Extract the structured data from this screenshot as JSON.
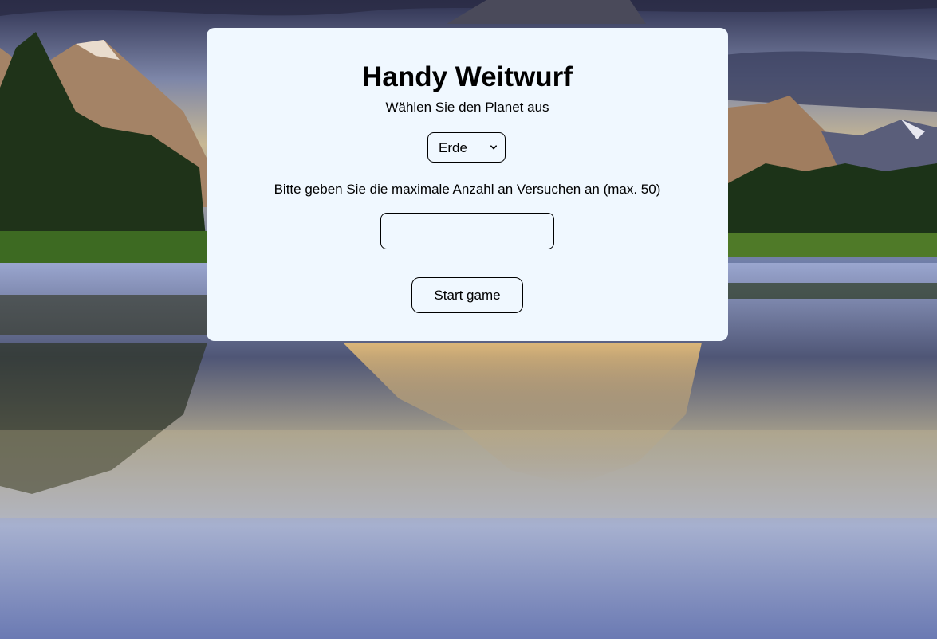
{
  "page": {
    "background": "mountain-lake-landscape"
  },
  "card": {
    "title": "Handy Weitwurf",
    "planet_prompt": "Wählen Sie den Planet aus",
    "planet_select": {
      "selected": "Erde",
      "icon": "chevron-down-icon"
    },
    "attempts_prompt": "Bitte geben Sie die maximale Anzahl an Versuchen an (max. 50)",
    "attempts_input": {
      "value": "",
      "placeholder": ""
    },
    "start_button_label": "Start game"
  },
  "colors": {
    "card_background": "#f0f8ff",
    "text": "#000000",
    "border": "#000000"
  }
}
